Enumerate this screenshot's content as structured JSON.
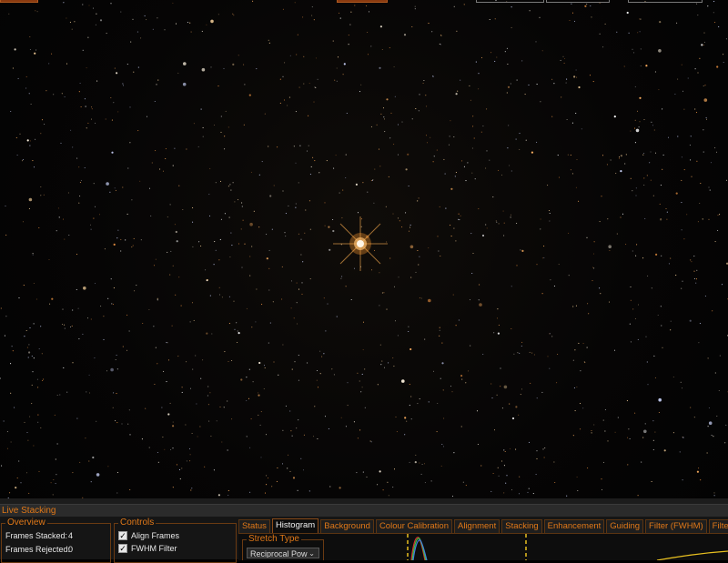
{
  "panel": {
    "title": "Live Stacking",
    "overview": {
      "label": "Overview",
      "frames_stacked_label": "Frames Stacked:",
      "frames_stacked_value": "4",
      "frames_rejected_label": "Frames Rejected:",
      "frames_rejected_value": "0"
    },
    "controls": {
      "label": "Controls",
      "align_frames": "Align Frames",
      "fwhm_filter": "FWHM Filter"
    },
    "tabs": [
      "Status",
      "Histogram",
      "Background",
      "Colour Calibration",
      "Alignment",
      "Stacking",
      "Enhancement",
      "Guiding",
      "Filter (FWHM)",
      "Filter (Bright"
    ],
    "active_tab": "Histogram",
    "stretch": {
      "label": "Stretch Type",
      "value": "Reciprocal Pow"
    }
  },
  "colors": {
    "accent": "#e07818",
    "panel_bg": "#151515",
    "sky_bg": "#050505"
  },
  "icons": {
    "checkbox": "checkmark-icon",
    "dropdown": "chevron-down-icon"
  }
}
